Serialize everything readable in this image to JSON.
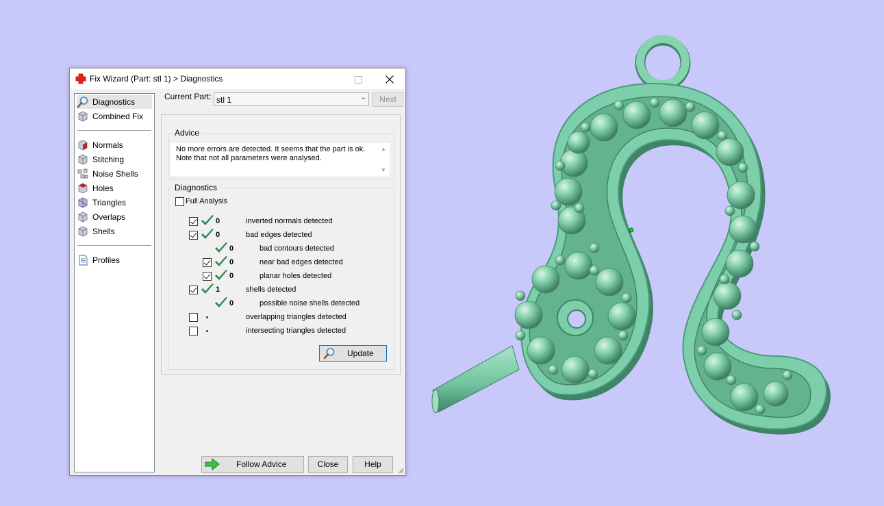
{
  "dialog": {
    "title": "Fix Wizard (Part: stl 1) > Diagnostics",
    "icons": {
      "app": "red-cross-icon",
      "close": "close-icon",
      "maximize": "maximize-icon",
      "minimize": "minimize-icon"
    }
  },
  "sidebar": {
    "groups": [
      [
        {
          "label": "Diagnostics",
          "icon": "magnifier-icon",
          "active": true
        },
        {
          "label": "Combined Fix",
          "icon": "cube-icon"
        }
      ],
      [
        {
          "label": "Normals",
          "icon": "normals-cube-icon"
        },
        {
          "label": "Stitching",
          "icon": "stitching-cube-icon"
        },
        {
          "label": "Noise Shells",
          "icon": "noise-shells-icon"
        },
        {
          "label": "Holes",
          "icon": "holes-cube-icon"
        },
        {
          "label": "Triangles",
          "icon": "triangles-cube-icon"
        },
        {
          "label": "Overlaps",
          "icon": "overlaps-cube-icon"
        },
        {
          "label": "Shells",
          "icon": "shells-cube-icon"
        }
      ],
      [
        {
          "label": "Profiles",
          "icon": "profiles-document-icon"
        }
      ]
    ]
  },
  "current_part": {
    "label": "Current Part:",
    "value": "stl 1",
    "next_label": "Next"
  },
  "advice": {
    "title": "Advice",
    "line1": "No more errors are detected. It seems that the part is ok.",
    "line2": "Note that not all parameters were analysed."
  },
  "diagnostics": {
    "title": "Diagnostics",
    "full_analysis": {
      "label": "Full Analysis",
      "checked": false
    },
    "rows": [
      {
        "label": "inverted normals detected",
        "count": "0",
        "checkbox": true,
        "checked": true,
        "status": "ok",
        "indent": 0
      },
      {
        "label": "bad edges detected",
        "count": "0",
        "checkbox": true,
        "checked": true,
        "status": "ok",
        "indent": 0
      },
      {
        "label": "bad contours detected",
        "count": "0",
        "checkbox": false,
        "checked": false,
        "status": "ok",
        "indent": 1
      },
      {
        "label": "near bad edges detected",
        "count": "0",
        "checkbox": true,
        "checked": true,
        "status": "ok",
        "indent": 1
      },
      {
        "label": "planar holes detected",
        "count": "0",
        "checkbox": true,
        "checked": true,
        "status": "ok",
        "indent": 1
      },
      {
        "label": "shells detected",
        "count": "1",
        "checkbox": true,
        "checked": true,
        "status": "ok",
        "indent": 0
      },
      {
        "label": "possible noise shells detected",
        "count": "0",
        "checkbox": false,
        "checked": false,
        "status": "ok",
        "indent": 1
      },
      {
        "label": "overlapping triangles detected",
        "count": "",
        "checkbox": true,
        "checked": false,
        "status": "not-analysed",
        "indent": 0
      },
      {
        "label": "intersecting triangles detected",
        "count": "",
        "checkbox": true,
        "checked": false,
        "status": "not-analysed",
        "indent": 0
      }
    ],
    "update_label": "Update"
  },
  "footer": {
    "follow_advice": "Follow Advice",
    "close": "Close",
    "help": "Help"
  },
  "colors": {
    "background": "#c9c8fb",
    "model": "#7ccfaa",
    "check": "#2f8f4c",
    "dot": "#2b2bd0",
    "accent": "#0078d7"
  }
}
